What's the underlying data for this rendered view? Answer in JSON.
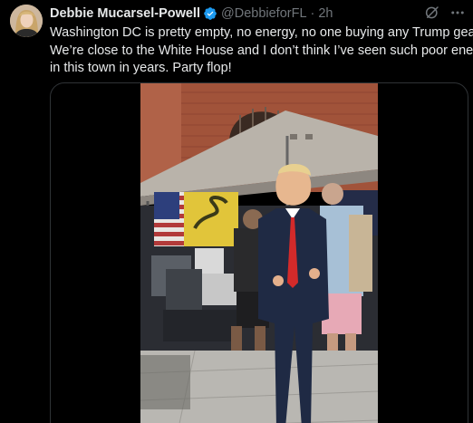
{
  "tweet": {
    "author_name": "Debbie Mucarsel-Powell",
    "handle": "@DebbieforFL",
    "separator": "·",
    "time": "2h",
    "text_lines": [
      "Washington DC is pretty empty, no energy, no one buying any Trump gear.",
      "We’re close to the White House and I don’t think I’ve seen such poor energy",
      "in this town in years. Party flop!"
    ]
  },
  "icons": {
    "verified": "verified-badge-icon",
    "grok": "grok-icon",
    "more": "more-icon"
  },
  "colors": {
    "background": "#000000",
    "text_primary": "#e7e9ea",
    "text_secondary": "#71767b",
    "verified_blue": "#1d9bf0",
    "border": "#2f3336"
  }
}
